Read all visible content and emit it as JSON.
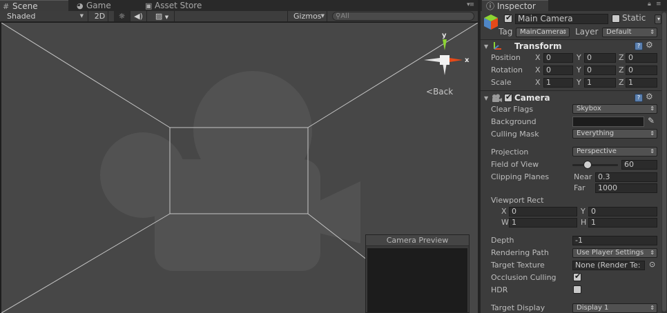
{
  "scene_tabs": [
    {
      "label": "Scene",
      "icon": "grid-icon"
    },
    {
      "label": "Game",
      "icon": "pacman-icon"
    },
    {
      "label": "Asset Store",
      "icon": "bag-icon"
    }
  ],
  "toolbar": {
    "shading_mode": "Shaded",
    "mode_2d_label": "2D",
    "gizmos_label": "Gizmos",
    "search_placeholder": "All"
  },
  "gizmo": {
    "y_label": "y",
    "x_label": "x",
    "back_label": "Back"
  },
  "camera_preview": {
    "title": "Camera Preview"
  },
  "inspector": {
    "tab_label": "Inspector",
    "object_name": "Main Camera",
    "static_label": "Static",
    "tag_label": "Tag",
    "tag_value": "MainCamera",
    "layer_label": "Layer",
    "layer_value": "Default",
    "transform": {
      "title": "Transform",
      "rows": [
        {
          "label": "Position",
          "x": "0",
          "y": "0",
          "z": "0"
        },
        {
          "label": "Rotation",
          "x": "0",
          "y": "0",
          "z": "0"
        },
        {
          "label": "Scale",
          "x": "1",
          "y": "1",
          "z": "1"
        }
      ],
      "axis_x": "X",
      "axis_y": "Y",
      "axis_z": "Z"
    },
    "camera": {
      "title": "Camera",
      "clear_flags_label": "Clear Flags",
      "clear_flags_value": "Skybox",
      "background_label": "Background",
      "background_color": "#1c1c1c",
      "culling_mask_label": "Culling Mask",
      "culling_mask_value": "Everything",
      "projection_label": "Projection",
      "projection_value": "Perspective",
      "fov_label": "Field of View",
      "fov_value": "60",
      "fov_fraction": 0.33,
      "clipping_label": "Clipping Planes",
      "near_label": "Near",
      "near_value": "0.3",
      "far_label": "Far",
      "far_value": "1000",
      "viewport_label": "Viewport Rect",
      "vp_x_label": "X",
      "vp_x": "0",
      "vp_y_label": "Y",
      "vp_y": "0",
      "vp_w_label": "W",
      "vp_w": "1",
      "vp_h_label": "H",
      "vp_h": "1",
      "depth_label": "Depth",
      "depth_value": "-1",
      "rendering_path_label": "Rendering Path",
      "rendering_path_value": "Use Player Settings",
      "target_texture_label": "Target Texture",
      "target_texture_value": "None (Render Te:",
      "occlusion_label": "Occlusion Culling",
      "hdr_label": "HDR",
      "target_display_label": "Target Display",
      "target_display_value": "Display 1"
    }
  },
  "colors": {
    "gizmo_x": "#e64a19",
    "gizmo_y": "#8dd433",
    "gizmo_z": "#4f86c6",
    "accent": "#5a7fae"
  }
}
